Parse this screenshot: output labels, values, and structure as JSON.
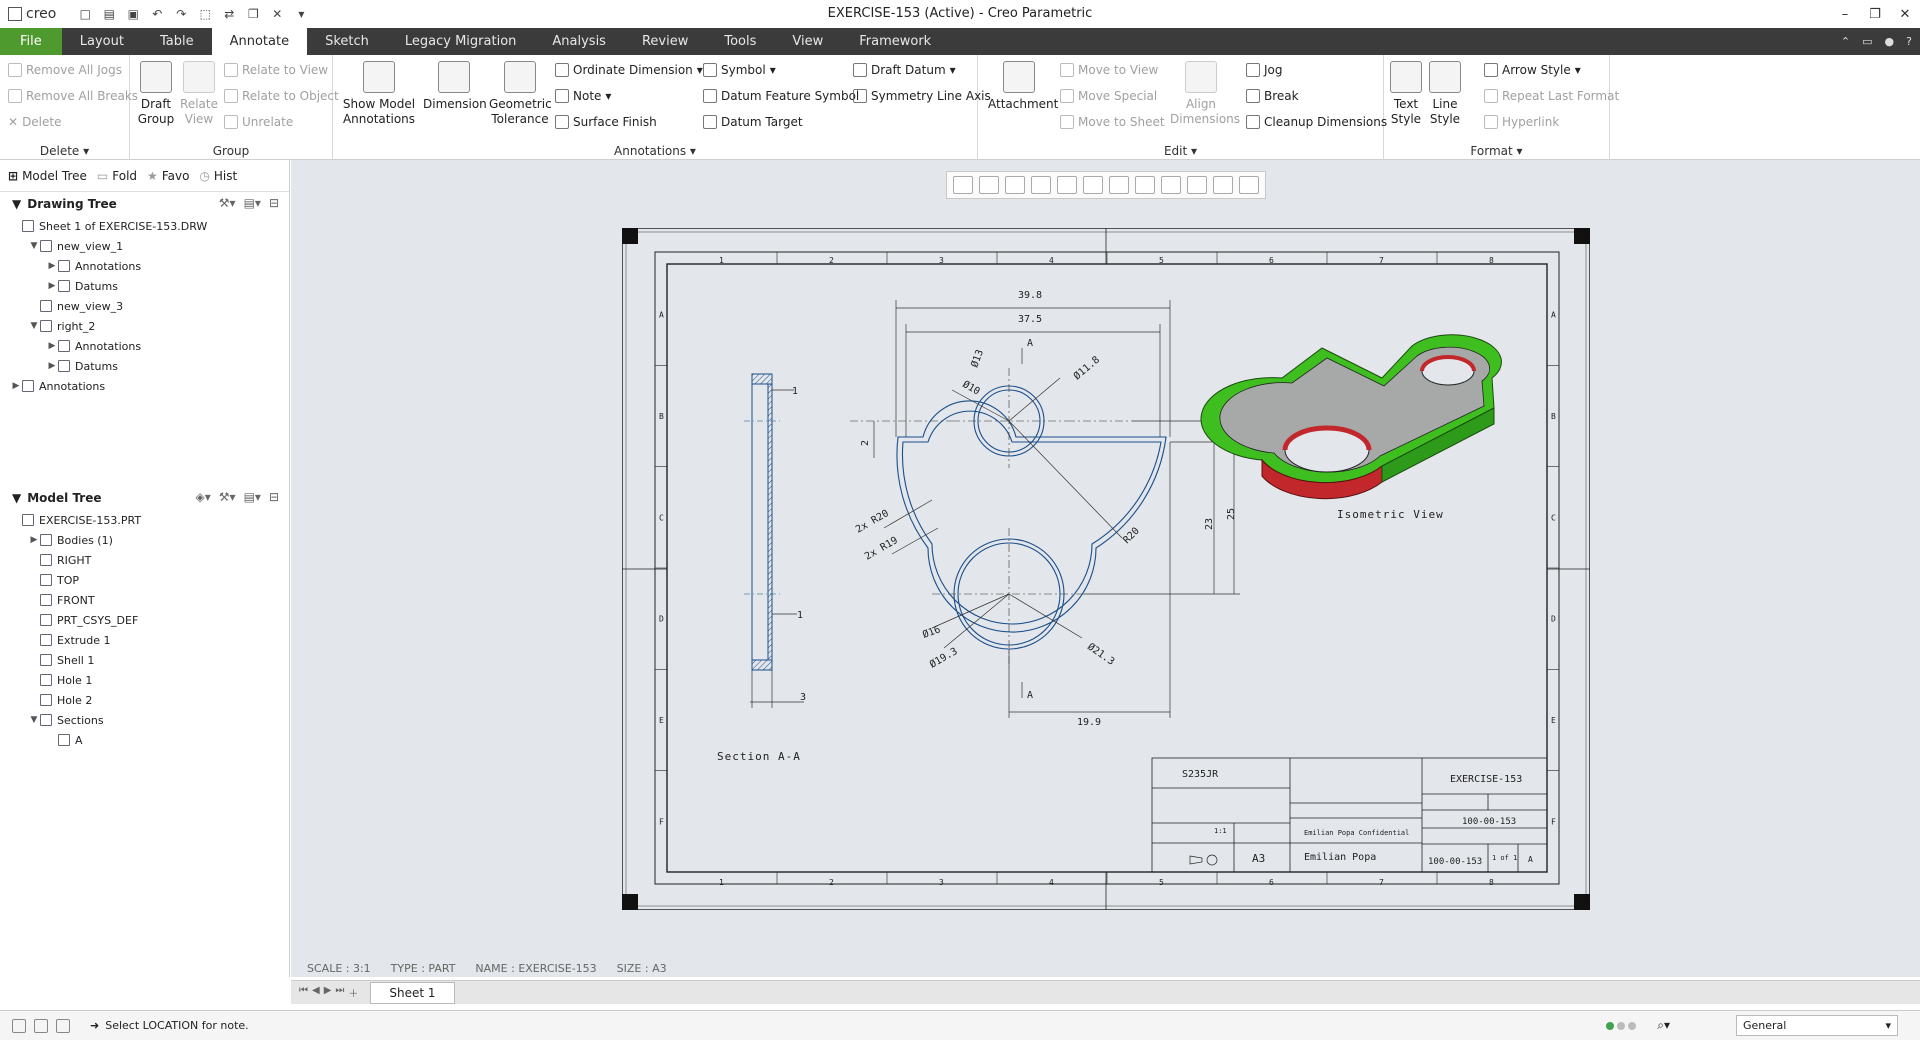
{
  "app": {
    "logo_text": "creo",
    "title": "EXERCISE-153 (Active) - Creo Parametric"
  },
  "tabs": [
    "File",
    "Layout",
    "Table",
    "Annotate",
    "Sketch",
    "Legacy Migration",
    "Analysis",
    "Review",
    "Tools",
    "View",
    "Framework"
  ],
  "ribbon": {
    "delete": {
      "label": "Delete",
      "items": [
        "Remove All Jogs",
        "Remove All Breaks",
        "Delete"
      ]
    },
    "group": {
      "label": "Group",
      "draft_group": "Draft Group",
      "relate_view": "Relate View",
      "items": [
        "Relate to View",
        "Relate to Object",
        "Unrelate"
      ]
    },
    "annotations": {
      "label": "Annotations",
      "show_model": "Show Model Annotations",
      "dimension": "Dimension",
      "geometric_tolerance": "Geometric Tolerance",
      "items": [
        "Ordinate Dimension",
        "Note",
        "Surface Finish",
        "Symbol",
        "Datum Feature Symbol",
        "Datum Target",
        "Draft Datum",
        "Symmetry Line Axis"
      ]
    },
    "edit": {
      "label": "Edit",
      "attachment": "Attachment",
      "align": "Align Dimensions",
      "items": [
        "Move to View",
        "Move Special",
        "Move to Sheet",
        "Jog",
        "Break",
        "Cleanup Dimensions"
      ]
    },
    "format": {
      "label": "Format",
      "text_style": "Text Style",
      "line_style": "Line Style",
      "items": [
        "Arrow Style",
        "Repeat Last Format",
        "Hyperlink"
      ]
    }
  },
  "panel_tabs": [
    "Model Tree",
    "Fold",
    "Favo",
    "Hist"
  ],
  "drawing_tree": {
    "title": "Drawing Tree",
    "nodes": [
      {
        "label": "Sheet 1 of EXERCISE-153.DRW",
        "level": 0,
        "tw": ""
      },
      {
        "label": "new_view_1",
        "level": 1,
        "tw": "▼"
      },
      {
        "label": "Annotations",
        "level": 2,
        "tw": "▶"
      },
      {
        "label": "Datums",
        "level": 2,
        "tw": "▶"
      },
      {
        "label": "new_view_3",
        "level": 1,
        "tw": ""
      },
      {
        "label": "right_2",
        "level": 1,
        "tw": "▼"
      },
      {
        "label": "Annotations",
        "level": 2,
        "tw": "▶"
      },
      {
        "label": "Datums",
        "level": 2,
        "tw": "▶"
      },
      {
        "label": "Annotations",
        "level": 0,
        "tw": "▶"
      }
    ]
  },
  "model_tree": {
    "title": "Model Tree",
    "nodes": [
      {
        "label": "EXERCISE-153.PRT",
        "level": 0,
        "tw": ""
      },
      {
        "label": "Bodies (1)",
        "level": 1,
        "tw": "▶"
      },
      {
        "label": "RIGHT",
        "level": 1,
        "tw": ""
      },
      {
        "label": "TOP",
        "level": 1,
        "tw": ""
      },
      {
        "label": "FRONT",
        "level": 1,
        "tw": ""
      },
      {
        "label": "PRT_CSYS_DEF",
        "level": 1,
        "tw": ""
      },
      {
        "label": "Extrude 1",
        "level": 1,
        "tw": ""
      },
      {
        "label": "Shell 1",
        "level": 1,
        "tw": ""
      },
      {
        "label": "Hole 1",
        "level": 1,
        "tw": ""
      },
      {
        "label": "Hole 2",
        "level": 1,
        "tw": ""
      },
      {
        "label": "Sections",
        "level": 1,
        "tw": "▼"
      },
      {
        "label": "A",
        "level": 2,
        "tw": ""
      }
    ]
  },
  "drawing": {
    "zones_h": [
      "1",
      "2",
      "3",
      "4",
      "5",
      "6",
      "7",
      "8"
    ],
    "zones_v": [
      "A",
      "B",
      "C",
      "D",
      "E",
      "F"
    ],
    "dims": {
      "d398": "39.8",
      "d375": "37.5",
      "d13": "Ø13",
      "d10": "Ø10",
      "d118": "Ø11.8",
      "r20a": "2x R20",
      "r19": "2x R19",
      "r20b": "R20",
      "d16": "Ø16",
      "d193": "Ø19.3",
      "d213": "Ø21.3",
      "d199": "19.9",
      "d23": "23",
      "d25": "25",
      "d2": "2",
      "d1a": "1",
      "d1b": "1",
      "d3": "3",
      "secA1": "A",
      "secA2": "A"
    },
    "section_label": "Section A-A",
    "iso_label": "Isometric View",
    "title_block": {
      "material": "S235JR",
      "description": "EXERCISE-153",
      "scale": "1:1",
      "size": "A3",
      "company": "Emilian Popa",
      "confidential": "Emilian Popa Confidential",
      "part_number": "100-00-153",
      "dwg_number": "100-00-153",
      "sheet": "1 of 1",
      "revision": "A"
    }
  },
  "status_info": [
    "SCALE : 3:1",
    "TYPE : PART",
    "NAME : EXERCISE-153",
    "SIZE : A3"
  ],
  "sheet_tab": "Sheet 1",
  "message": "Select LOCATION for note.",
  "filter": "General",
  "colors": {
    "file_tab": "#4e9a2e",
    "tabbar": "#3b3b3b",
    "canvas": "#e3e6ea",
    "geometry": "#1b4f8a",
    "iso_green": "#3fbf1f",
    "iso_red": "#c2282b"
  }
}
